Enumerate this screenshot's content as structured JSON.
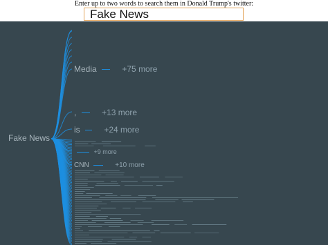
{
  "header": {
    "prompt": "Enter up to two words to search them in Donald Trump's twitter:",
    "search_value": "Fake News"
  },
  "tree": {
    "root_label": "Fake News",
    "link_color": "#1d8fe1",
    "background": "#37474f",
    "branches": [
      {
        "label": "Media",
        "more": "+75 more"
      },
      {
        "label": ",",
        "more": "+13 more"
      },
      {
        "label": "is",
        "more": "+24 more"
      },
      {
        "label": "",
        "more": "+9 more"
      },
      {
        "label": "CNN",
        "more": "+10 more"
      }
    ]
  }
}
